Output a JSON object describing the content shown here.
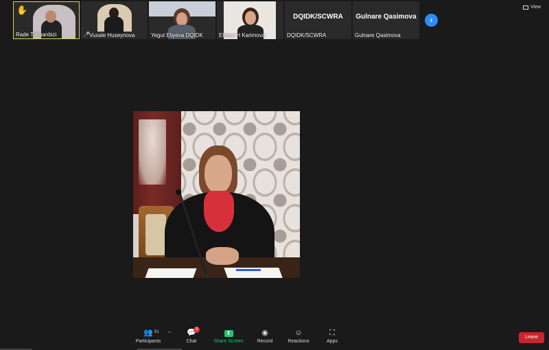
{
  "gallery": {
    "tiles": [
      {
        "name": "Rade Tofmanbizi",
        "raised_hand": true,
        "muted": false
      },
      {
        "name": "Vusale Huseynova",
        "raised_hand": false,
        "muted": true
      },
      {
        "name": "Yegut Eliyeva DQIDK",
        "raised_hand": false,
        "muted": false
      },
      {
        "name": "Elnera H Karimova",
        "raised_hand": false,
        "muted": false
      },
      {
        "name": "DQIDK/SCWRA",
        "display": "DQIDK/SCWRA",
        "raised_hand": false,
        "muted": false
      },
      {
        "name": "Gulnare Qasimova",
        "display": "Gulnare Qasimova",
        "raised_hand": false,
        "muted": false
      }
    ],
    "next_icon": "chevron-right-icon",
    "view_label": "View"
  },
  "toolbar": {
    "participants": {
      "label": "Participants",
      "count": "51"
    },
    "chat": {
      "label": "Chat",
      "badge": "3"
    },
    "share": {
      "label": "Share Screen"
    },
    "record": {
      "label": "Record"
    },
    "reactions": {
      "label": "Reactions"
    },
    "apps": {
      "label": "Apps"
    },
    "leave": {
      "label": "Leave"
    }
  },
  "colors": {
    "background": "#1a1a1a",
    "accent": "#2d8cff",
    "share_green": "#23c86a",
    "leave_red": "#c8262c",
    "active_border": "#d8cf6a"
  }
}
